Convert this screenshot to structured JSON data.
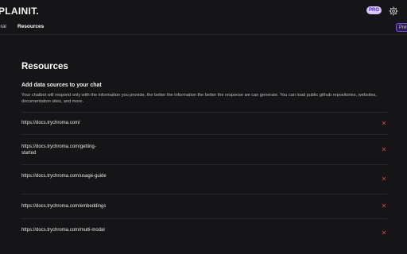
{
  "app": {
    "logo": "PLAINIT.",
    "badge": "PRO",
    "settings_icon": "gear-icon"
  },
  "tabs": [
    {
      "label": "eral"
    },
    {
      "label": "Resources",
      "active": true
    }
  ],
  "preview_button": {
    "label": "Prev"
  },
  "page": {
    "title": "Resources",
    "section_title": "Add data sources to your chat",
    "section_desc": "Your chatbot will respond only with the information you provide, the better the information the better the response we can generate. You can load public github repositories, websites, documentation sites, and more."
  },
  "resources": [
    {
      "url": "https://docs.trychroma.com/"
    },
    {
      "url": "https://docs.trychroma.com/getting-started"
    },
    {
      "url": "https://docs.trychroma.com/usage-guide"
    },
    {
      "url": "https://docs.trychroma.com/embeddings"
    },
    {
      "url": "https://docs.trychroma.com/multi-modal"
    }
  ],
  "colors": {
    "background": "#151517",
    "accent": "#7c4dff",
    "remove": "#d64545",
    "badge_bg": "#d9c6ff"
  }
}
